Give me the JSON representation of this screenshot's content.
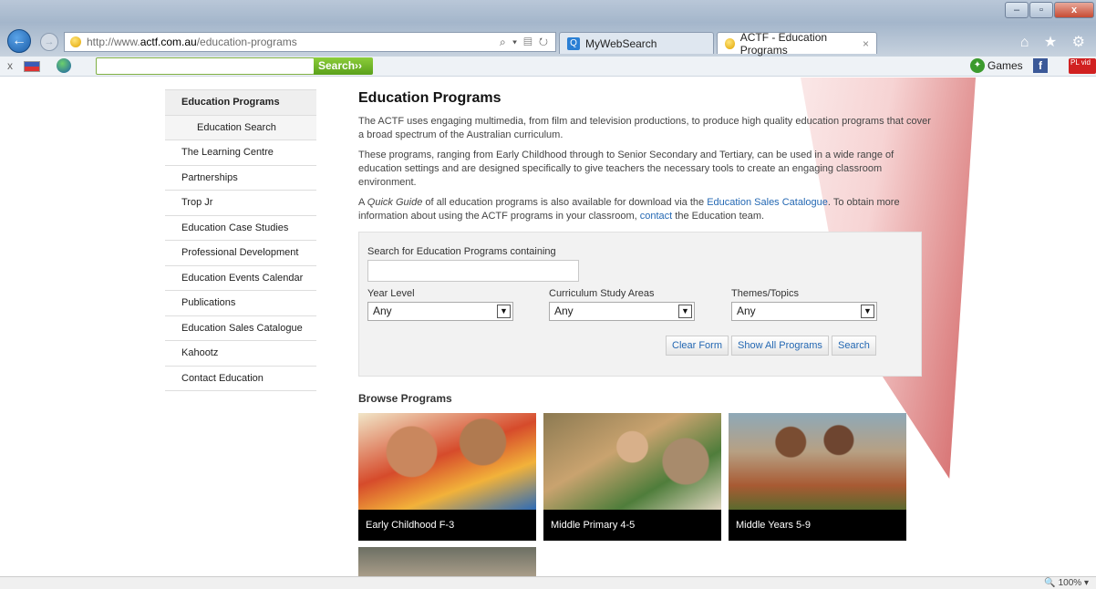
{
  "browser": {
    "url_prefix": "http://www.",
    "url_domain": "actf.com.au",
    "url_path": "/education-programs",
    "address_icons": "⌕ ▾ ▤ ↻",
    "tabs": [
      {
        "label": "MyWebSearch",
        "icon": "search-icon"
      },
      {
        "label": "ACTF - Education Programs",
        "icon": "favicon",
        "close": "×"
      }
    ],
    "window_buttons": {
      "minimize": "–",
      "maximize": "▫",
      "close": "x"
    },
    "right_icons": "⌂ ★ ⚙"
  },
  "toolbar": {
    "close": "x",
    "search_placeholder": "",
    "search_button": "Search››",
    "games_label": "Games",
    "facebook": "f",
    "youtube": "PL vid"
  },
  "sidebar": {
    "items": [
      {
        "label": "Education Programs"
      },
      {
        "label": "Education Search"
      },
      {
        "label": "The Learning Centre"
      },
      {
        "label": "Partnerships"
      },
      {
        "label": "Trop Jr"
      },
      {
        "label": "Education Case Studies"
      },
      {
        "label": "Professional Development"
      },
      {
        "label": "Education Events Calendar"
      },
      {
        "label": "Publications"
      },
      {
        "label": "Education Sales Catalogue"
      },
      {
        "label": "Kahootz"
      },
      {
        "label": "Contact Education"
      }
    ]
  },
  "main": {
    "title": "Education Programs",
    "para1": "The ACTF uses engaging multimedia, from film and television productions, to produce high quality education programs that cover a broad spectrum of the Australian curriculum.",
    "para2": "These programs, ranging from Early Childhood through to Senior Secondary and Tertiary, can be used in a wide range of education settings and are designed specifically to give teachers the necessary tools to create an engaging classroom environment.",
    "para3_a": "A ",
    "para3_em": "Quick Guide",
    "para3_b": " of all education programs is also available for download via the ",
    "para3_link1": "Education Sales Catalogue",
    "para3_c": ". To obtain more information about using the ACTF programs in your classroom, ",
    "para3_link2": "contact",
    "para3_d": " the Education team."
  },
  "search_form": {
    "label": "Search for Education Programs containing",
    "input_value": "",
    "year_label": "Year Level",
    "year_value": "Any",
    "curriculum_label": "Curriculum Study Areas",
    "curriculum_value": "Any",
    "themes_label": "Themes/Topics",
    "themes_value": "Any",
    "arrow": "▼",
    "clear_button": "Clear Form",
    "show_all_button": "Show All Programs",
    "search_button": "Search"
  },
  "browse": {
    "title": "Browse Programs",
    "tiles": [
      {
        "caption": "Early Childhood F-3"
      },
      {
        "caption": "Middle Primary 4-5"
      },
      {
        "caption": "Middle Years 5-9"
      }
    ]
  },
  "status": {
    "zoom": "🔍 100%  ▾"
  },
  "colors": {
    "link": "#2468b3",
    "accent_swoosh": "#d65a5a"
  }
}
